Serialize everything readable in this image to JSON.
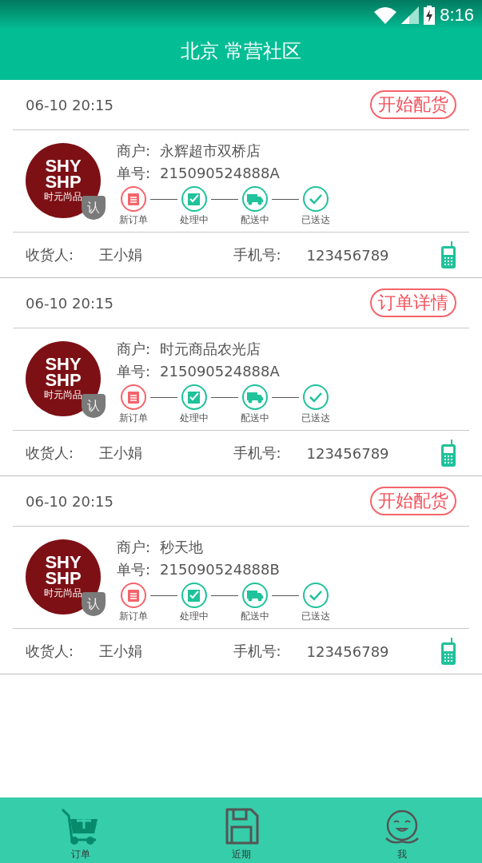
{
  "status_bar": {
    "time": "8:16"
  },
  "title": "北京 常营社区",
  "orders": [
    {
      "time": "06-10  20:15",
      "action": "开始配货",
      "logo": [
        "SHY",
        "SHP",
        "时元尚品"
      ],
      "badge": "认",
      "merchant_label": "商户:",
      "merchant": "永辉超市双桥店",
      "number_label": "单号:",
      "number": "215090524888A",
      "steps": [
        {
          "kind": "new",
          "label": "新订单",
          "color": "#f4646b"
        },
        {
          "kind": "processing",
          "label": "处理中",
          "color": "#1fc29b"
        },
        {
          "kind": "delivering",
          "label": "配送中",
          "color": "#1fc29b"
        },
        {
          "kind": "delivered",
          "label": "已送达",
          "color": "#1fc29b"
        }
      ],
      "recipient_label": "收货人:",
      "recipient": "王小娟",
      "phone_label": "手机号:",
      "phone": "123456789"
    },
    {
      "time": "06-10  20:15",
      "action": "订单详情",
      "logo": [
        "SHY",
        "SHP",
        "时元尚品"
      ],
      "badge": "认",
      "merchant_label": "商户:",
      "merchant": "时元商品农光店",
      "number_label": "单号:",
      "number": "215090524888A",
      "steps": [
        {
          "kind": "new",
          "label": "新订单",
          "color": "#f4646b"
        },
        {
          "kind": "processing",
          "label": "处理中",
          "color": "#1fc29b"
        },
        {
          "kind": "delivering",
          "label": "配送中",
          "color": "#1fc29b"
        },
        {
          "kind": "delivered",
          "label": "已送达",
          "color": "#1fc29b"
        }
      ],
      "recipient_label": "收货人:",
      "recipient": "王小娟",
      "phone_label": "手机号:",
      "phone": "123456789"
    },
    {
      "time": "06-10  20:15",
      "action": "开始配货",
      "logo": [
        "SHY",
        "SHP",
        "时元尚品"
      ],
      "badge": "认",
      "merchant_label": "商户:",
      "merchant": "秒天地",
      "number_label": "单号:",
      "number": "215090524888B",
      "steps": [
        {
          "kind": "new",
          "label": "新订单",
          "color": "#f4646b"
        },
        {
          "kind": "processing",
          "label": "处理中",
          "color": "#1fc29b"
        },
        {
          "kind": "delivering",
          "label": "配送中",
          "color": "#1fc29b"
        },
        {
          "kind": "delivered",
          "label": "已送达",
          "color": "#1fc29b"
        }
      ],
      "recipient_label": "收货人:",
      "recipient": "王小娟",
      "phone_label": "手机号:",
      "phone": "123456789"
    }
  ],
  "nav": [
    {
      "kind": "cart",
      "label": "订单",
      "selected": true
    },
    {
      "kind": "save",
      "label": "近期",
      "selected": false
    },
    {
      "kind": "me",
      "label": "我",
      "selected": false
    }
  ]
}
